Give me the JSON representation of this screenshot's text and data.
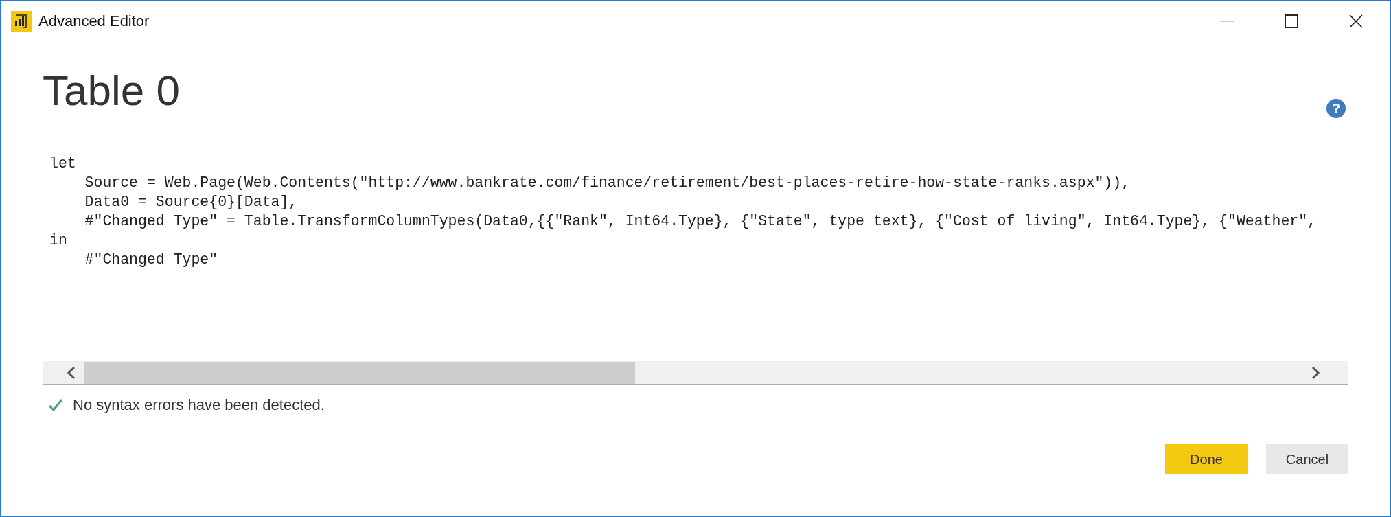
{
  "window": {
    "title": "Advanced Editor",
    "controls": [
      {
        "kind": "minimize",
        "disabled": true
      },
      {
        "kind": "maximize",
        "disabled": false
      },
      {
        "kind": "close",
        "disabled": false
      }
    ]
  },
  "heading": "Table 0",
  "help": {
    "label": "?"
  },
  "editor": {
    "lines": [
      "let",
      "    Source = Web.Page(Web.Contents(\"http://www.bankrate.com/finance/retirement/best-places-retire-how-state-ranks.aspx\")),",
      "    Data0 = Source{0}[Data],",
      "    #\"Changed Type\" = Table.TransformColumnTypes(Data0,{{\"Rank\", Int64.Type}, {\"State\", type text}, {\"Cost of living\", Int64.Type}, {\"Weather\",",
      "in",
      "    #\"Changed Type\""
    ]
  },
  "status": {
    "kind": "ok",
    "message": "No syntax errors have been detected."
  },
  "buttons": [
    {
      "label": "Done",
      "kind": "primary"
    },
    {
      "label": "Cancel",
      "kind": "secondary"
    }
  ]
}
